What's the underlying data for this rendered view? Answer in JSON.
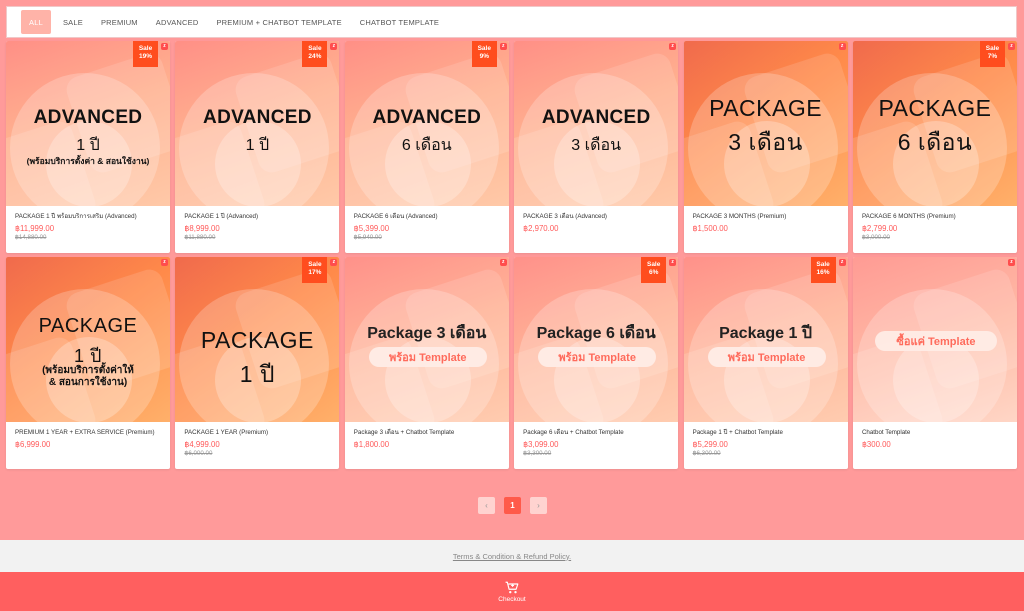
{
  "tabs": [
    "ALL",
    "SALE",
    "PREMIUM",
    "ADVANCED",
    "PREMIUM + CHATBOT TEMPLATE",
    "CHATBOT TEMPLATE"
  ],
  "products": [
    {
      "style": "adv",
      "l1": "ADVANCED",
      "l2": "1 ปี",
      "l3": "(พร้อมบริการตั้งค่า & สอนใช้งาน)",
      "sale": [
        "Sale",
        "19%"
      ],
      "name": "PACKAGE 1 ปี พร้อมบริการเสริม (Advanced)",
      "price": "฿11,999.00",
      "old": "฿14,880.00"
    },
    {
      "style": "adv",
      "l1": "ADVANCED",
      "l2": "1 ปี",
      "l3": "",
      "sale": [
        "Sale",
        "24%"
      ],
      "name": "PACKAGE 1 ปี (Advanced)",
      "price": "฿8,999.00",
      "old": "฿11,880.00"
    },
    {
      "style": "adv",
      "l1": "ADVANCED",
      "l2": "6 เดือน",
      "l3": "",
      "sale": [
        "Sale",
        "9%"
      ],
      "name": "PACKAGE 6 เดือน (Advanced)",
      "price": "฿5,399.00",
      "old": "฿5,940.00"
    },
    {
      "style": "adv",
      "l1": "ADVANCED",
      "l2": "3 เดือน",
      "l3": "",
      "sale": null,
      "name": "PACKAGE 3 เดือน (Advanced)",
      "price": "฿2,970.00",
      "old": ""
    },
    {
      "style": "pkg",
      "l1": "PACKAGE",
      "l2": "3 เดือน",
      "l3": "",
      "sale": null,
      "name": "PACKAGE 3 MONTHS (Premium)",
      "price": "฿1,500.00",
      "old": ""
    },
    {
      "style": "pkg",
      "l1": "PACKAGE",
      "l2": "6 เดือน",
      "l3": "",
      "sale": [
        "Sale",
        "7%"
      ],
      "name": "PACKAGE 6 MONTHS (Premium)",
      "price": "฿2,799.00",
      "old": "฿3,000.00"
    },
    {
      "style": "pkg-note",
      "l1": "PACKAGE",
      "l2": "1 ปี",
      "l3": "(พร้อมบริการตั้งค่าให้",
      "l4": "& สอนการใช้งาน)",
      "sale": null,
      "name": "PREMIUM 1 YEAR + EXTRA SERVICE (Premium)",
      "price": "฿6,999.00",
      "old": ""
    },
    {
      "style": "pkg",
      "l1": "PACKAGE",
      "l2": "1 ปี",
      "l3": "",
      "sale": [
        "Sale",
        "17%"
      ],
      "name": "PACKAGE 1 YEAR (Premium)",
      "price": "฿4,999.00",
      "old": "฿6,000.00"
    },
    {
      "style": "tpl",
      "l1": "Package 3 เดือน",
      "l2": "พร้อม Template",
      "l3": "",
      "sale": null,
      "name": "Package 3 เดือน + Chatbot Template",
      "price": "฿1,800.00",
      "old": ""
    },
    {
      "style": "tpl",
      "l1": "Package 6 เดือน",
      "l2": "พร้อม Template",
      "l3": "",
      "sale": [
        "Sale",
        "6%"
      ],
      "name": "Package 6 เดือน + Chatbot Template",
      "price": "฿3,099.00",
      "old": "฿3,300.00"
    },
    {
      "style": "tpl",
      "l1": "Package 1 ปี",
      "l2": "พร้อม Template",
      "l3": "",
      "sale": [
        "Sale",
        "16%"
      ],
      "name": "Package 1 ปี + Chatbot Template",
      "price": "฿5,299.00",
      "old": "฿6,300.00"
    },
    {
      "style": "only",
      "l1": "",
      "l2": "ซื้อแค่ Template",
      "l3": "",
      "sale": null,
      "name": "Chatbot Template",
      "price": "฿300.00",
      "old": ""
    }
  ],
  "pagination": {
    "prev": "‹",
    "current": "1",
    "next": "›"
  },
  "footer": {
    "terms": "Terms & Condition & Refund Policy.",
    "checkout": "Checkout"
  },
  "colors": {
    "background": "#ff9a9a",
    "accent": "#ff5a5a",
    "sale_badge": "#ff4d1e",
    "checkout_bar": "#ff5f5f"
  },
  "icons": {
    "brand_badge": "z-logo-icon",
    "cart": "cart-icon",
    "prev": "chevron-left-icon",
    "next": "chevron-right-icon"
  }
}
